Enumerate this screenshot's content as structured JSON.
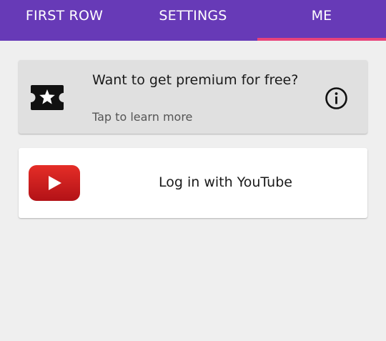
{
  "tabs": [
    {
      "label": "FIRST ROW",
      "selected": false
    },
    {
      "label": "SETTINGS",
      "selected": false
    },
    {
      "label": "ME",
      "selected": true
    }
  ],
  "premium_card": {
    "title": "Want to get premium for free?",
    "subtitle": "Tap to learn more",
    "icon": "ticket-star-icon",
    "action_icon": "info-icon"
  },
  "youtube_card": {
    "label": "Log in with YouTube",
    "icon": "youtube-logo-icon"
  },
  "colors": {
    "app_bar": "#673ab7",
    "tab_indicator": "#e9437a",
    "background": "#efefef",
    "premium_card": "#e0e0e0",
    "youtube_red": "#e52d27"
  }
}
